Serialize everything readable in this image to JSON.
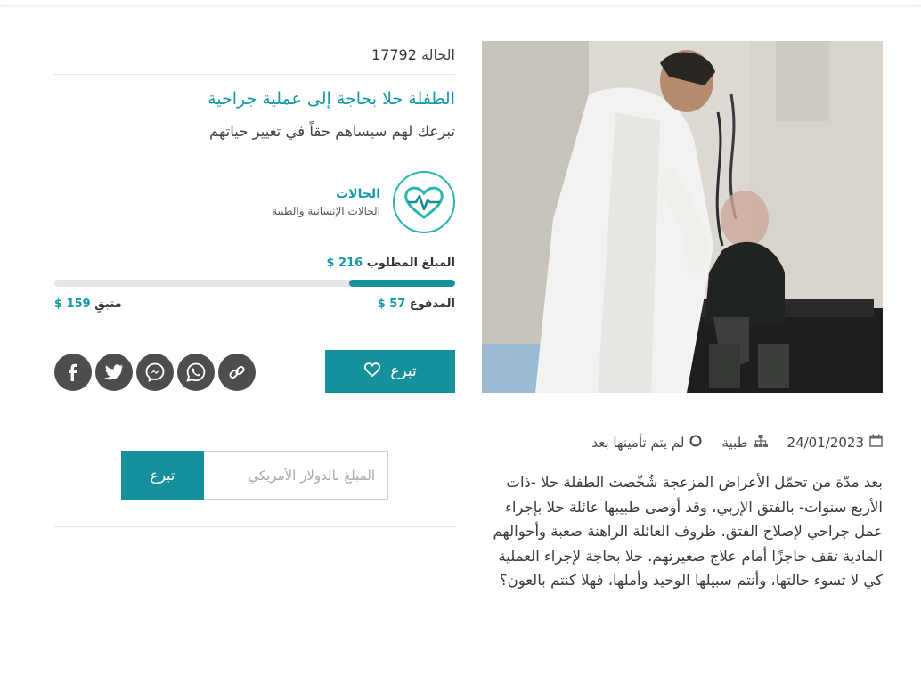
{
  "case": {
    "id_label": "الحالة",
    "id_number": "17792",
    "title": "الطفلة حلا بحاجة إلى عملية جراحية",
    "subtitle": "تبرعك لهم سيساهم حقاً في تغيير حياتهم"
  },
  "category": {
    "icon": "heart-pulse-icon",
    "title": "الحالات",
    "subtitle": "الحالات الإنسانية والطبية"
  },
  "funding": {
    "goal_label": "المبلغ المطلوب",
    "goal_amount": "216 $",
    "paid_label": "المدفوع",
    "paid_amount": "57 $",
    "remaining_label": "متبقٍ",
    "remaining_amount": "159 $",
    "progress_fraction": 0.264
  },
  "actions": {
    "donate_label": "تبرع",
    "donate_icon": "heart-outline-icon",
    "share_icons": [
      "link-icon",
      "whatsapp-icon",
      "messenger-icon",
      "twitter-icon",
      "facebook-icon"
    ]
  },
  "amount_form": {
    "placeholder": "المبلغ بالدولار الأمريكي",
    "value": "",
    "button_label": "تبرع"
  },
  "meta": {
    "date": "24/01/2023",
    "date_icon": "calendar-icon",
    "type": "طبية",
    "type_icon": "sitemap-icon",
    "status": "لم يتم تأمينها بعد",
    "status_icon": "circle-outline-icon"
  },
  "description": "بعد مدّة من تحمّل الأعراض المزعجة شُخّصت الطفلة حلا -ذات الأربع سنوات- بالفتق الإربي، وقد أوصى طبيبها عائلة حلا بإجراء عمل جراحي لإصلاح الفتق. ظروف العائلة الراهنة صعبة وأحوالهم المادية تقف حاجزًا أمام علاج صغيرتهم. حلا بحاجة لإجراء العملية كي لا تسوء حالتها، وأنتم سبيلها الوحيد وأملها، فهلا كنتم بالعون؟",
  "colors": {
    "accent": "#16919c",
    "accent_text": "#1699a6",
    "share_bg": "#4d4d4d"
  }
}
